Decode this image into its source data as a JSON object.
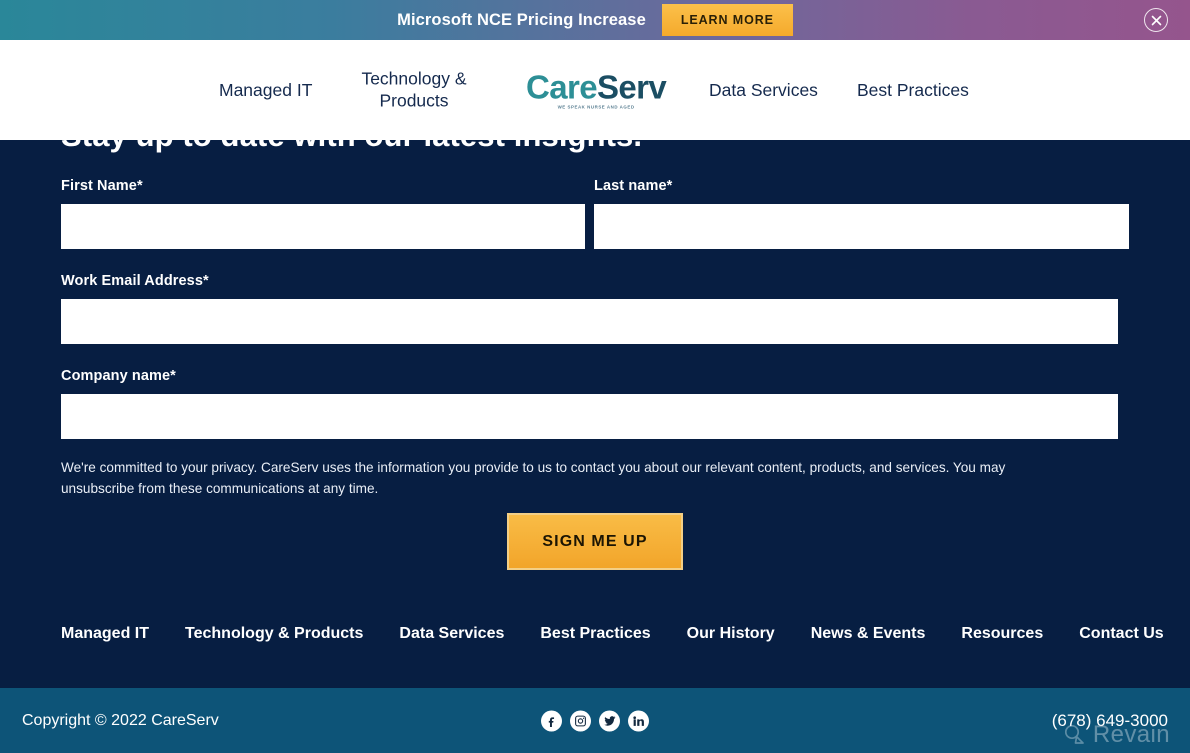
{
  "promo_banner": {
    "message": "Microsoft NCE Pricing Increase",
    "cta_label": "LEARN MORE",
    "close_icon": "close-circle-icon",
    "gradient_start": "#2a8799",
    "gradient_end": "#95558d",
    "cta_color": "#f5aa2c"
  },
  "header": {
    "brand": {
      "name_part1": "Care",
      "name_part2": "Serv",
      "tagline": "WE SPEAK NURSE AND AGED",
      "color_part1": "#2d8f96",
      "color_part2": "#1b4e63"
    },
    "nav": [
      {
        "label": "Managed IT"
      },
      {
        "label": "Technology &\nProducts"
      },
      {
        "label": "Data Services"
      },
      {
        "label": "Best Practices"
      }
    ]
  },
  "signup": {
    "heading": "Stay up to date with our latest insights.",
    "background_color": "#071e42",
    "fields": [
      {
        "label": "First Name*",
        "value": "",
        "placeholder": ""
      },
      {
        "label": "Last name*",
        "value": "",
        "placeholder": ""
      },
      {
        "label": "Work Email Address*",
        "value": "",
        "placeholder": ""
      },
      {
        "label": "Company name*",
        "value": "",
        "placeholder": ""
      }
    ],
    "privacy_note": "We're committed to your privacy. CareServ uses the information you provide to us to contact you about our relevant content, products, and services. You may unsubscribe from these communications at any time.",
    "submit_label": "SIGN ME UP",
    "submit_color": "#f2a52a"
  },
  "footer": {
    "links": [
      {
        "label": "Managed IT"
      },
      {
        "label": "Technology & Products"
      },
      {
        "label": "Data Services"
      },
      {
        "label": "Best Practices"
      },
      {
        "label": "Our History"
      },
      {
        "label": "News & Events"
      },
      {
        "label": "Resources"
      },
      {
        "label": "Contact Us"
      }
    ]
  },
  "bottom_bar": {
    "copyright": "Copyright © 2022 CareServ",
    "phone": "(678) 649-3000",
    "background_color": "#0d5478",
    "social": [
      {
        "name": "facebook-icon"
      },
      {
        "name": "instagram-icon"
      },
      {
        "name": "twitter-icon"
      },
      {
        "name": "linkedin-icon"
      }
    ]
  },
  "watermark": {
    "text": "Revain"
  }
}
